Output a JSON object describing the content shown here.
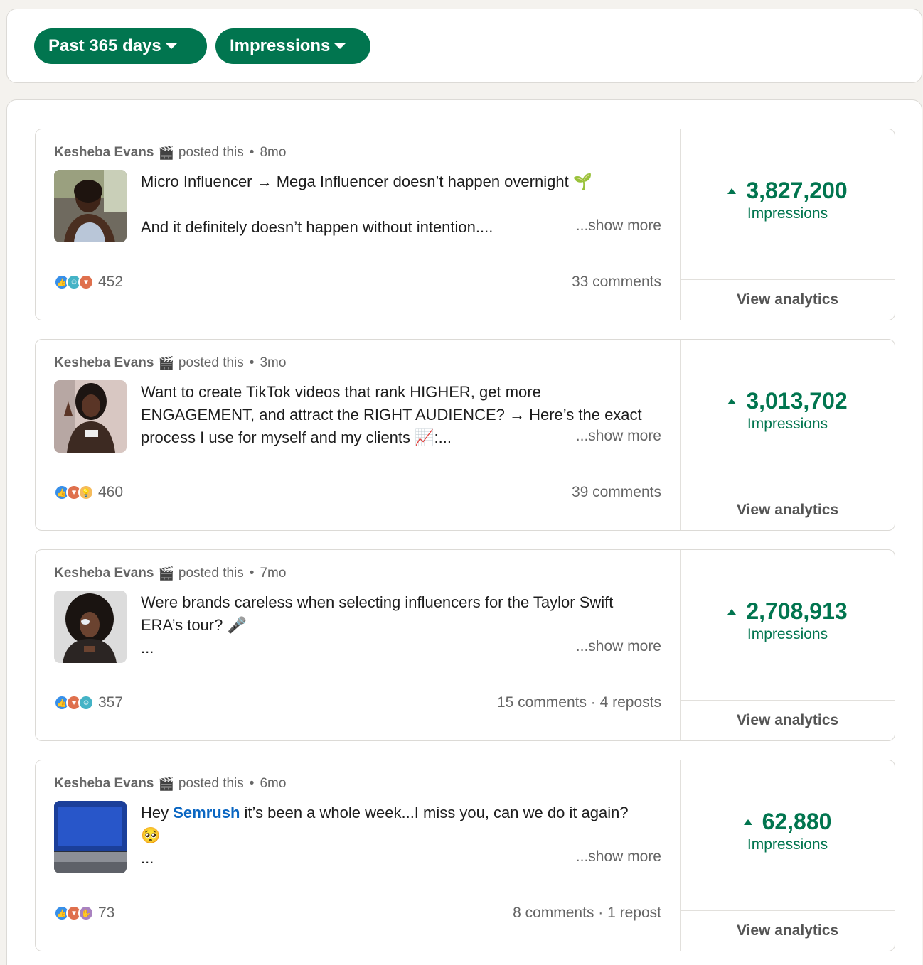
{
  "filters": {
    "period_label": "Past 365 days",
    "metric_label": "Impressions"
  },
  "posts": [
    {
      "author": "Kesheba Evans",
      "posted_this": "posted this",
      "age": "8mo",
      "lines": [
        "Micro Influencer → Mega Influencer doesn’t happen overnight 🌱",
        "",
        "And it definitely doesn’t happen without intention...."
      ],
      "show_more": "...show more",
      "reactions": [
        "like",
        "celebrate",
        "love"
      ],
      "reaction_count": "452",
      "comments": "33 comments",
      "impressions": "3,827,200",
      "impressions_label": "Impressions",
      "view_analytics": "View analytics"
    },
    {
      "author": "Kesheba Evans",
      "posted_this": "posted this",
      "age": "3mo",
      "lines": [
        "Want to create TikTok videos that rank HIGHER, get more",
        "ENGAGEMENT, and attract the RIGHT AUDIENCE? → Here’s the exact",
        "process I use for myself and my clients 📈:..."
      ],
      "show_more": "...show more",
      "reactions": [
        "like",
        "love",
        "insight"
      ],
      "reaction_count": "460",
      "comments": "39 comments",
      "impressions": "3,013,702",
      "impressions_label": "Impressions",
      "view_analytics": "View analytics"
    },
    {
      "author": "Kesheba Evans",
      "posted_this": "posted this",
      "age": "7mo",
      "lines": [
        "Were brands careless when selecting influencers for the Taylor Swift",
        "ERA’s tour? 🎤",
        "..."
      ],
      "show_more": "...show more",
      "reactions": [
        "like",
        "love",
        "celebrate"
      ],
      "reaction_count": "357",
      "comments": "15 comments · 4 reposts",
      "impressions": "2,708,913",
      "impressions_label": "Impressions",
      "view_analytics": "View analytics"
    },
    {
      "author": "Kesheba Evans",
      "posted_this": "posted this",
      "age": "6mo",
      "line1_before": "Hey ",
      "line1_link": "Semrush",
      "line1_after": " it’s been a whole week...I miss you, can we do it again?",
      "lines": [
        "🥺",
        "..."
      ],
      "show_more": "...show more",
      "reactions": [
        "like",
        "love",
        "support"
      ],
      "reaction_count": "73",
      "comments": "8 comments · 1 repost",
      "impressions": "62,880",
      "impressions_label": "Impressions",
      "view_analytics": "View analytics"
    }
  ],
  "colors": {
    "accent_green": "#01754f",
    "link_blue": "#0a66c2",
    "page_bg": "#f4f2ee"
  }
}
